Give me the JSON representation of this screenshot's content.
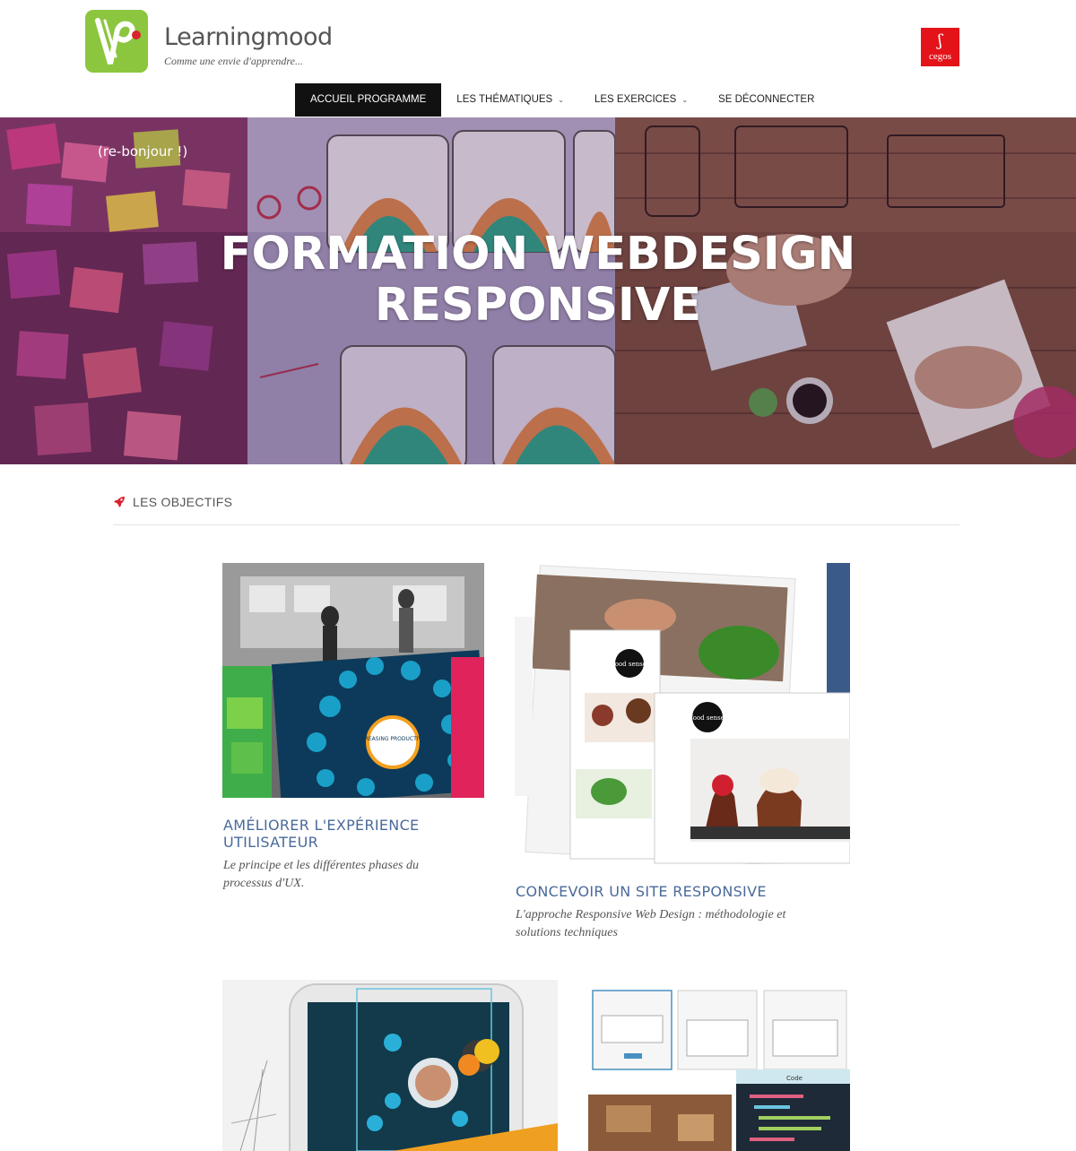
{
  "header": {
    "brand_name": "Learningmood",
    "tagline": "Comme une envie d'apprendre...",
    "partner_name": "cegos"
  },
  "nav": {
    "items": [
      {
        "label": "ACCUEIL PROGRAMME",
        "active": true,
        "dropdown": false
      },
      {
        "label": "LES THÉMATIQUES",
        "active": false,
        "dropdown": true
      },
      {
        "label": "LES EXERCICES",
        "active": false,
        "dropdown": true
      },
      {
        "label": "SE DÉCONNECTER",
        "active": false,
        "dropdown": false
      }
    ]
  },
  "hero": {
    "greeting": "(re-bonjour !)",
    "title_line1": "FORMATION WEBDESIGN",
    "title_line2": "RESPONSIVE"
  },
  "section": {
    "icon": "rocket-icon",
    "title": "LES OBJECTIFS"
  },
  "cards": [
    {
      "title_line1": "AMÉLIORER L'EXPÉRIENCE",
      "title_line2": "UTILISATEUR",
      "desc_line1": "Le principe et les différentes phases du",
      "desc_line2": "processus d'UX."
    },
    {
      "title_line1": "CONCEVOIR UN SITE RESPONSIVE",
      "title_line2": "",
      "desc_line1": "L'approche Responsive Web Design : méthodologie et",
      "desc_line2": "solutions techniques"
    }
  ],
  "images": {
    "card1_label": "INCREASING PRODUCTIVITY",
    "card2_brand": "food sense",
    "card4_code_tab": "Code"
  },
  "colors": {
    "brand_green": "#8cc63f",
    "partner_red": "#e4131a",
    "nav_active_bg": "#111111",
    "card_title": "#4a6a9a"
  }
}
